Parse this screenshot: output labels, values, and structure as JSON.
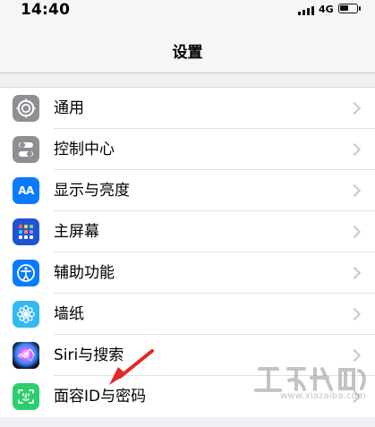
{
  "status_bar": {
    "time": "14:40",
    "network": "4G"
  },
  "navigation": {
    "title": "设置"
  },
  "settings": [
    {
      "label": "通用",
      "icon": "gear-icon"
    },
    {
      "label": "控制中心",
      "icon": "control-center-icon"
    },
    {
      "label": "显示与亮度",
      "icon": "aa-icon"
    },
    {
      "label": "主屏幕",
      "icon": "home-screen-icon"
    },
    {
      "label": "辅助功能",
      "icon": "accessibility-icon"
    },
    {
      "label": "墙纸",
      "icon": "wallpaper-icon"
    },
    {
      "label": "Siri与搜索",
      "icon": "siri-icon"
    },
    {
      "label": "面容ID与密码",
      "icon": "face-id-icon"
    }
  ],
  "watermark": {
    "url": "www.xiazaiba.com"
  },
  "icons": {
    "display": "AA"
  },
  "colors": {
    "background": "#efeff4",
    "chevron": "#c7c7cc",
    "blue": "#0a7bff",
    "green": "#2ccf6d",
    "red_arrow": "#e52626"
  }
}
